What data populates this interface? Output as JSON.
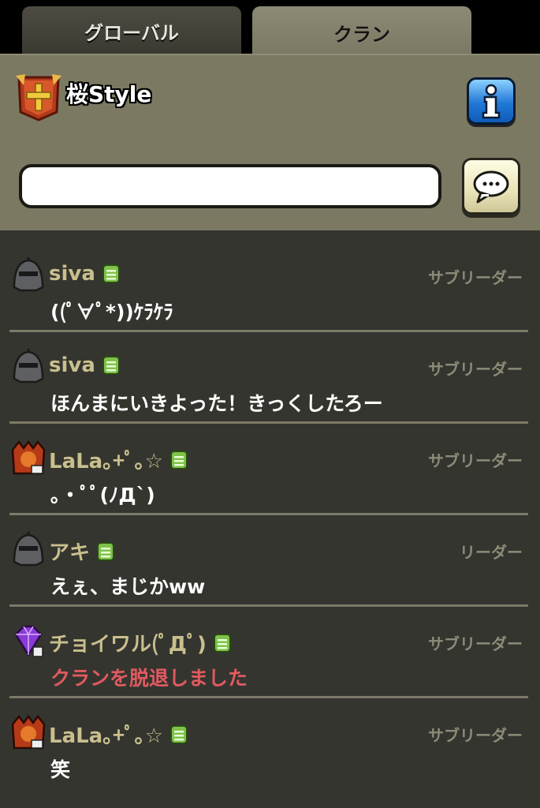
{
  "tabs": {
    "global_label": "グローバル",
    "clan_label": "クラン"
  },
  "clan": {
    "name": "桜Style"
  },
  "input": {
    "value": "",
    "placeholder": ""
  },
  "colors": {
    "header_bg": "#7b7962",
    "message_bg": "#34352f",
    "username": "#c9bf8e",
    "role": "#8d8b78",
    "system_text": "#e05a60",
    "info_button": "#2178d6"
  },
  "messages": [
    {
      "username": "siva",
      "role": "サブリーダー",
      "text": "((ﾟ∀ﾟ*))ｹﾗｹﾗ",
      "avatar": "knight-helmet-icon",
      "system": false
    },
    {
      "username": "siva",
      "role": "サブリーダー",
      "text": "ほんまにいきよった！きっくしたろー",
      "avatar": "knight-helmet-icon",
      "system": false
    },
    {
      "username": "LaLa｡+ﾟ｡☆",
      "role": "サブリーダー",
      "text": "｡・ﾟﾟ(ﾉД`)",
      "avatar": "barbarian-king-icon",
      "system": false
    },
    {
      "username": "アキ",
      "role": "リーダー",
      "text": "えぇ、まじかww",
      "avatar": "knight-helmet-icon",
      "system": false
    },
    {
      "username": "チョイワル(ﾟДﾟ)",
      "role": "サブリーダー",
      "text": "クランを脱退しました",
      "avatar": "purple-gem-icon",
      "system": true
    },
    {
      "username": "LaLa｡+ﾟ｡☆",
      "role": "サブリーダー",
      "text": "笑",
      "avatar": "barbarian-king-icon",
      "system": false
    }
  ]
}
